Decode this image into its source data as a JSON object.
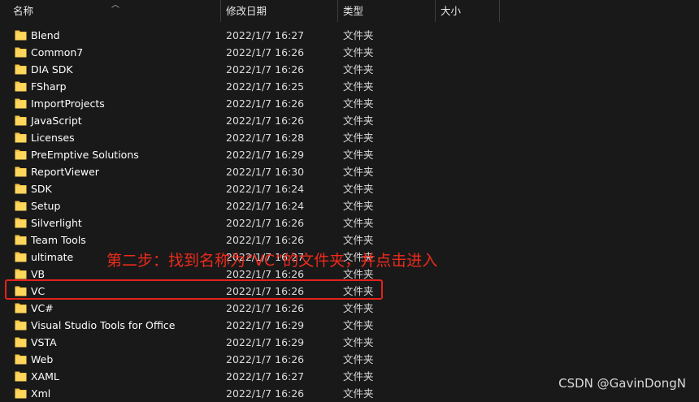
{
  "columns": {
    "name": "名称",
    "date": "修改日期",
    "type": "类型",
    "size": "大小"
  },
  "rows": [
    {
      "name": "Blend",
      "date": "2022/1/7 16:27",
      "type": "文件夹"
    },
    {
      "name": "Common7",
      "date": "2022/1/7 16:26",
      "type": "文件夹"
    },
    {
      "name": "DIA SDK",
      "date": "2022/1/7 16:26",
      "type": "文件夹"
    },
    {
      "name": "FSharp",
      "date": "2022/1/7 16:25",
      "type": "文件夹"
    },
    {
      "name": "ImportProjects",
      "date": "2022/1/7 16:26",
      "type": "文件夹"
    },
    {
      "name": "JavaScript",
      "date": "2022/1/7 16:26",
      "type": "文件夹"
    },
    {
      "name": "Licenses",
      "date": "2022/1/7 16:28",
      "type": "文件夹"
    },
    {
      "name": "PreEmptive Solutions",
      "date": "2022/1/7 16:29",
      "type": "文件夹"
    },
    {
      "name": "ReportViewer",
      "date": "2022/1/7 16:30",
      "type": "文件夹"
    },
    {
      "name": "SDK",
      "date": "2022/1/7 16:24",
      "type": "文件夹"
    },
    {
      "name": "Setup",
      "date": "2022/1/7 16:24",
      "type": "文件夹"
    },
    {
      "name": "Silverlight",
      "date": "2022/1/7 16:26",
      "type": "文件夹"
    },
    {
      "name": "Team Tools",
      "date": "2022/1/7 16:26",
      "type": "文件夹"
    },
    {
      "name": "ultimate",
      "date": "2022/1/7 16:27",
      "type": "文件夹"
    },
    {
      "name": "VB",
      "date": "2022/1/7 16:26",
      "type": "文件夹"
    },
    {
      "name": "VC",
      "date": "2022/1/7 16:26",
      "type": "文件夹"
    },
    {
      "name": "VC#",
      "date": "2022/1/7 16:26",
      "type": "文件夹"
    },
    {
      "name": "Visual Studio Tools for Office",
      "date": "2022/1/7 16:29",
      "type": "文件夹"
    },
    {
      "name": "VSTA",
      "date": "2022/1/7 16:29",
      "type": "文件夹"
    },
    {
      "name": "Web",
      "date": "2022/1/7 16:26",
      "type": "文件夹"
    },
    {
      "name": "XAML",
      "date": "2022/1/7 16:27",
      "type": "文件夹"
    },
    {
      "name": "Xml",
      "date": "2022/1/7 16:26",
      "type": "文件夹"
    }
  ],
  "annotation": "第二步：找到名称为“VC”的文件夹，并点击进入",
  "watermark": "CSDN @GavinDongN",
  "colors": {
    "background": "#191919",
    "folder": "#f5c443",
    "highlight": "#e4221a",
    "annotation": "#ee2a1c"
  },
  "icons": {
    "folder": "folder-icon",
    "sort": "sort-up-icon"
  }
}
